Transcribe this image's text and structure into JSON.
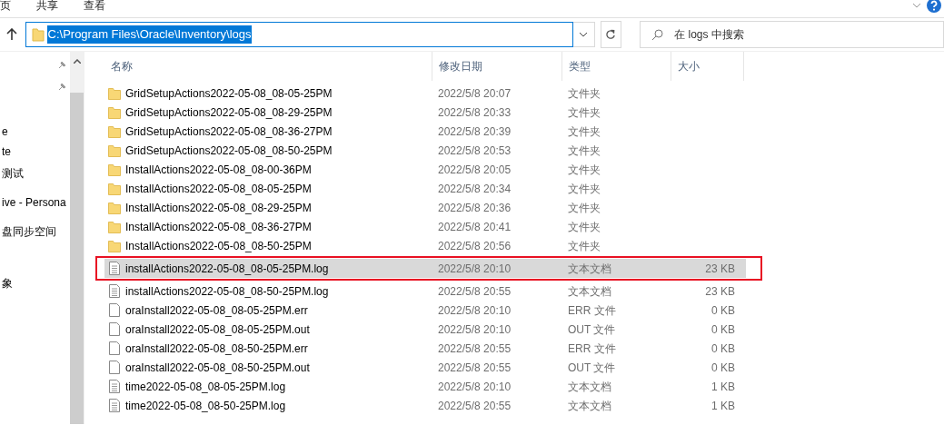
{
  "ribbon": {
    "tabs": [
      {
        "label": "页",
        "selected": false
      },
      {
        "label": "共享",
        "selected": false
      },
      {
        "label": "查看",
        "selected": false
      }
    ]
  },
  "address_bar": {
    "path": "C:\\Program Files\\Oracle\\Inventory\\logs",
    "selected": true
  },
  "search": {
    "placeholder": "在 logs 中搜索"
  },
  "sidebar": {
    "items": [
      {
        "label": "e",
        "pinned": false
      },
      {
        "label": "te",
        "pinned": false
      },
      {
        "label": "测试",
        "pinned": false
      },
      {
        "label": "ive - Persona",
        "pinned": false
      },
      {
        "label": "盘同步空间",
        "pinned": false
      },
      {
        "label": "象",
        "pinned": false
      }
    ]
  },
  "table": {
    "columns": [
      "名称",
      "修改日期",
      "类型",
      "大小"
    ],
    "rows": [
      {
        "kind": "folder",
        "name": "GridSetupActions2022-05-08_08-05-25PM",
        "date": "2022/5/8 20:07",
        "type": "文件夹",
        "size": "",
        "selected": false,
        "annotated": false
      },
      {
        "kind": "folder",
        "name": "GridSetupActions2022-05-08_08-29-25PM",
        "date": "2022/5/8 20:33",
        "type": "文件夹",
        "size": "",
        "selected": false,
        "annotated": false
      },
      {
        "kind": "folder",
        "name": "GridSetupActions2022-05-08_08-36-27PM",
        "date": "2022/5/8 20:39",
        "type": "文件夹",
        "size": "",
        "selected": false,
        "annotated": false
      },
      {
        "kind": "folder",
        "name": "GridSetupActions2022-05-08_08-50-25PM",
        "date": "2022/5/8 20:53",
        "type": "文件夹",
        "size": "",
        "selected": false,
        "annotated": false
      },
      {
        "kind": "folder",
        "name": "InstallActions2022-05-08_08-00-36PM",
        "date": "2022/5/8 20:05",
        "type": "文件夹",
        "size": "",
        "selected": false,
        "annotated": false
      },
      {
        "kind": "folder",
        "name": "InstallActions2022-05-08_08-05-25PM",
        "date": "2022/5/8 20:34",
        "type": "文件夹",
        "size": "",
        "selected": false,
        "annotated": false
      },
      {
        "kind": "folder",
        "name": "InstallActions2022-05-08_08-29-25PM",
        "date": "2022/5/8 20:36",
        "type": "文件夹",
        "size": "",
        "selected": false,
        "annotated": false
      },
      {
        "kind": "folder",
        "name": "InstallActions2022-05-08_08-36-27PM",
        "date": "2022/5/8 20:41",
        "type": "文件夹",
        "size": "",
        "selected": false,
        "annotated": false
      },
      {
        "kind": "folder",
        "name": "InstallActions2022-05-08_08-50-25PM",
        "date": "2022/5/8 20:56",
        "type": "文件夹",
        "size": "",
        "selected": false,
        "annotated": false
      },
      {
        "kind": "text",
        "name": "installActions2022-05-08_08-05-25PM.log",
        "date": "2022/5/8 20:10",
        "type": "文本文档",
        "size": "23 KB",
        "selected": true,
        "annotated": true
      },
      {
        "kind": "text",
        "name": "installActions2022-05-08_08-50-25PM.log",
        "date": "2022/5/8 20:55",
        "type": "文本文档",
        "size": "23 KB",
        "selected": false,
        "annotated": false
      },
      {
        "kind": "file",
        "name": "oraInstall2022-05-08_08-05-25PM.err",
        "date": "2022/5/8 20:10",
        "type": "ERR 文件",
        "size": "0 KB",
        "selected": false,
        "annotated": false
      },
      {
        "kind": "file",
        "name": "oraInstall2022-05-08_08-05-25PM.out",
        "date": "2022/5/8 20:10",
        "type": "OUT 文件",
        "size": "0 KB",
        "selected": false,
        "annotated": false
      },
      {
        "kind": "file",
        "name": "oraInstall2022-05-08_08-50-25PM.err",
        "date": "2022/5/8 20:55",
        "type": "ERR 文件",
        "size": "0 KB",
        "selected": false,
        "annotated": false
      },
      {
        "kind": "file",
        "name": "oraInstall2022-05-08_08-50-25PM.out",
        "date": "2022/5/8 20:55",
        "type": "OUT 文件",
        "size": "0 KB",
        "selected": false,
        "annotated": false
      },
      {
        "kind": "text",
        "name": "time2022-05-08_08-05-25PM.log",
        "date": "2022/5/8 20:10",
        "type": "文本文档",
        "size": "1 KB",
        "selected": false,
        "annotated": false
      },
      {
        "kind": "text",
        "name": "time2022-05-08_08-50-25PM.log",
        "date": "2022/5/8 20:55",
        "type": "文本文档",
        "size": "1 KB",
        "selected": false,
        "annotated": false
      }
    ]
  }
}
